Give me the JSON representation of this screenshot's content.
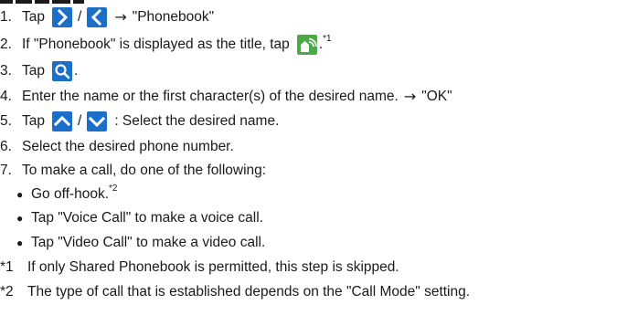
{
  "steps": [
    {
      "num": "1.",
      "pre": "Tap",
      "slash": "/",
      "arrow": "→",
      "post": "\"Phonebook\""
    },
    {
      "num": "2.",
      "pre": "If \"Phonebook\" is displayed as the title, tap",
      "post": ".",
      "sup": "*1"
    },
    {
      "num": "3.",
      "pre": "Tap",
      "post": "."
    },
    {
      "num": "4.",
      "pre": "Enter the name or the first character(s) of the desired name.",
      "arrow": "→",
      "post": "\"OK\""
    },
    {
      "num": "5.",
      "pre": "Tap",
      "slash": "/",
      "post": ": Select the desired name."
    },
    {
      "num": "6.",
      "text": "Select the desired phone number."
    },
    {
      "num": "7.",
      "text": "To make a call, do one of the following:"
    }
  ],
  "bullets": [
    {
      "text": "Go off-hook.",
      "sup": "*2"
    },
    {
      "text": "Tap \"Voice Call\" to make a voice call."
    },
    {
      "text": "Tap \"Video Call\" to make a video call."
    }
  ],
  "footnotes": [
    {
      "mark": "*1",
      "text": "If only Shared Phonebook is permitted, this step is skipped."
    },
    {
      "mark": "*2",
      "text": "The type of call that is established depends on the \"Call Mode\" setting."
    }
  ],
  "icons": {
    "blue": "#1c6fc9",
    "green": "#4ea84a",
    "forward": "chevron-right-icon",
    "back": "chevron-left-icon",
    "shared_phonebook": "shared-phonebook-icon",
    "search": "search-icon",
    "up": "chevron-up-icon",
    "down": "chevron-down-icon"
  }
}
